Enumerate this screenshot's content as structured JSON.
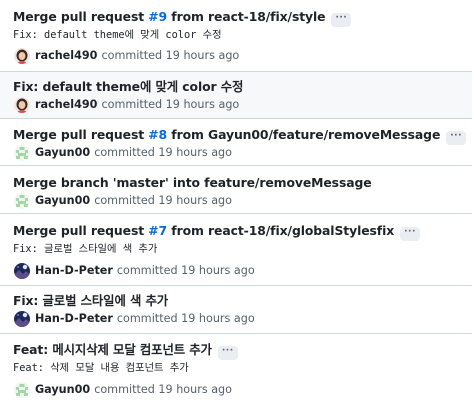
{
  "commits": [
    {
      "title_prefix": "Merge pull request ",
      "pr_number": "#9",
      "title_suffix": " from react-18/fix/style",
      "description": "Fix: default theme에 맞게 color 수정",
      "author": "rachel490",
      "author_avatar": "person-avatar",
      "committed": "committed 19 hours ago",
      "ellipsis": "···",
      "highlighted": false
    },
    {
      "title": "Fix: default theme에 맞게 color 수정",
      "author": "rachel490",
      "author_avatar": "person-avatar",
      "committed": "committed 19 hours ago",
      "highlighted": true
    },
    {
      "title_prefix": "Merge pull request ",
      "pr_number": "#8",
      "title_suffix": " from Gayun00/feature/removeMessage",
      "author": "Gayun00",
      "author_avatar": "identicon-avatar",
      "committed": "committed 19 hours ago",
      "ellipsis": "···",
      "highlighted": false
    },
    {
      "title": "Merge branch 'master' into feature/removeMessage",
      "author": "Gayun00",
      "author_avatar": "identicon-avatar",
      "committed": "committed 19 hours ago",
      "highlighted": false
    },
    {
      "title_prefix": "Merge pull request ",
      "pr_number": "#7",
      "title_suffix": " from react-18/fix/globalStylesfix",
      "description": "Fix: 글로벌 스타일에 색 추가",
      "author": "Han-D-Peter",
      "author_avatar": "night-sky-avatar",
      "committed": "committed 19 hours ago",
      "ellipsis": "···",
      "highlighted": false
    },
    {
      "title": "Fix: 글로벌 스타일에 색 추가",
      "author": "Han-D-Peter",
      "author_avatar": "night-sky-avatar",
      "committed": "committed 19 hours ago",
      "highlighted": false
    },
    {
      "title": "Feat: 메시지삭제 모달 컴포넌트 추가",
      "description": "Feat: 삭제 모달 내용 컴포넌트 추가",
      "author": "Gayun00",
      "author_avatar": "identicon-avatar",
      "committed": "committed 19 hours ago",
      "ellipsis": "···",
      "highlighted": false
    }
  ],
  "colors": {
    "link": "#0969da",
    "text": "#1f2328",
    "muted": "#57606a",
    "border": "#d0d7de",
    "highlight_bg": "#f6f8fa",
    "identicon": "#a5d6a7"
  }
}
